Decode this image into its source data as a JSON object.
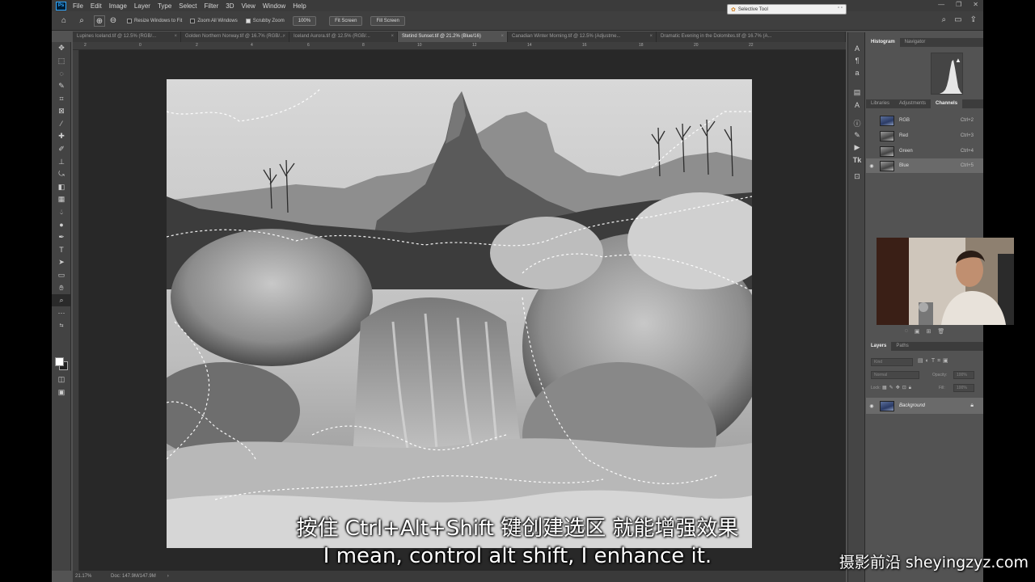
{
  "app": {
    "logo": "Ps",
    "menu": [
      "File",
      "Edit",
      "Image",
      "Layer",
      "Type",
      "Select",
      "Filter",
      "3D",
      "View",
      "Window",
      "Help"
    ],
    "window_controls": [
      "—",
      "❐",
      "✕"
    ]
  },
  "options_bar": {
    "resize_windows": "Resize Windows to Fit",
    "zoom_all": "Zoom All Windows",
    "scrubby_zoom": "Scrubby Zoom",
    "scrubby_checked": true,
    "btn_100": "100%",
    "btn_fit": "Fit Screen",
    "btn_fill": "Fill Screen"
  },
  "floating_tool": {
    "label": "Selective Tool"
  },
  "tabs": [
    {
      "label": "Lupines Iceland.tif @ 12.5% (RGB/...",
      "active": false
    },
    {
      "label": "Golden Northern Norway.tif @ 16.7% (RGB/...",
      "active": false
    },
    {
      "label": "Iceland Aurora.tif @ 12.5% (RGB/...",
      "active": false
    },
    {
      "label": "Stetind Sunset.tif @ 21.2% (Blue/16)",
      "active": true
    },
    {
      "label": "Canadian Winter Morning.tif @ 12.5% (Adjustme...",
      "active": false
    },
    {
      "label": "Dramatic Evening in the Dolomites.tif @ 16.7% (A...",
      "active": false
    }
  ],
  "ruler": {
    "ticks": [
      "2",
      "0",
      "2",
      "4",
      "6",
      "8",
      "10",
      "12",
      "14",
      "16",
      "18",
      "20",
      "22"
    ]
  },
  "status": {
    "zoom": "21.17%",
    "doc": "Doc: 147.9M/147.9M"
  },
  "panels": {
    "top_tabs": [
      "Histogram",
      "Navigator"
    ],
    "mid_tabs": [
      "Libraries",
      "Adjustments",
      "Channels"
    ],
    "channels": [
      {
        "name": "RGB",
        "key": "Ctrl+2",
        "selected": false,
        "visible": false
      },
      {
        "name": "Red",
        "key": "Ctrl+3",
        "selected": false,
        "visible": false
      },
      {
        "name": "Green",
        "key": "Ctrl+4",
        "selected": false,
        "visible": false
      },
      {
        "name": "Blue",
        "key": "Ctrl+5",
        "selected": true,
        "visible": true
      }
    ],
    "layers_tabs": [
      "Layers",
      "Paths"
    ],
    "layer_kind": "Kind",
    "blend_mode": "Normal",
    "opacity_label": "Opacity:",
    "opacity_value": "100%",
    "lock_label": "Lock:",
    "fill_label": "Fill:",
    "fill_value": "100%",
    "layer_name": "Background"
  },
  "subtitles": {
    "chinese": "按住 Ctrl+Alt+Shift 键创建选区 就能增强效果",
    "english": "I mean, control alt shift, I enhance it."
  },
  "watermark": "摄影前沿 sheyingzyz.com"
}
